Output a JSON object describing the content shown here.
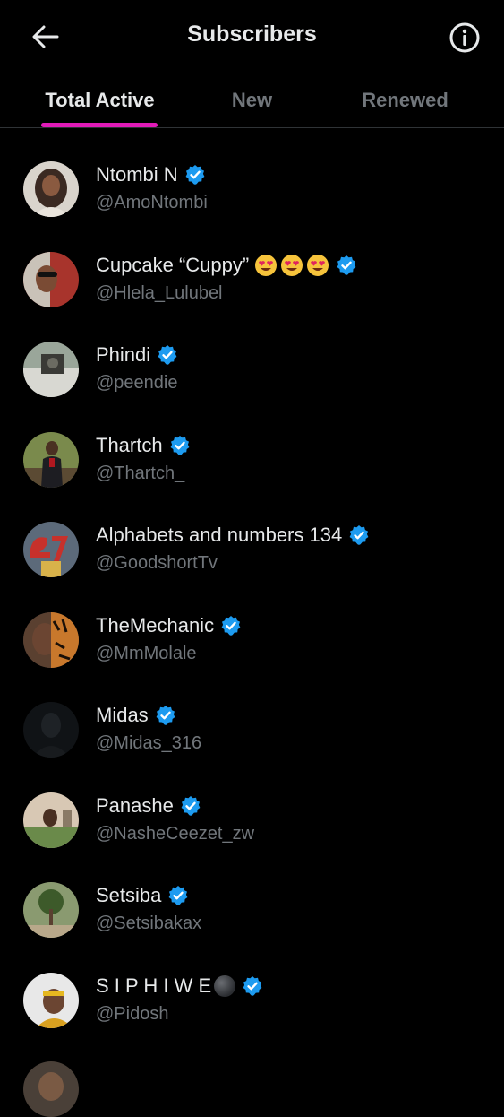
{
  "header": {
    "title": "Subscribers",
    "back_icon": "arrow-left-icon",
    "info_icon": "info-circle-icon"
  },
  "tabs": [
    {
      "label": "Total Active",
      "active": true
    },
    {
      "label": "New",
      "active": false
    },
    {
      "label": "Renewed",
      "active": false
    }
  ],
  "colors": {
    "background": "#000000",
    "primary_text": "#e7e9ea",
    "secondary_text": "#71767b",
    "tab_indicator": "#e11bb8",
    "verified_badge": "#1d9bf0"
  },
  "subscribers": [
    {
      "name": "Ntombi N",
      "handle": "@AmoNtombi",
      "verified": true
    },
    {
      "name": "Cupcake “Cuppy”",
      "handle": "@Hlela_Lulubel",
      "verified": true,
      "emojis": [
        "heart-eyes",
        "heart-eyes",
        "heart-eyes"
      ]
    },
    {
      "name": "Phindi",
      "handle": "@peendie",
      "verified": true
    },
    {
      "name": "Thartch",
      "handle": "@Thartch_",
      "verified": true
    },
    {
      "name": "Alphabets and numbers 134",
      "handle": "@GoodshortTv",
      "verified": true
    },
    {
      "name": "TheMechanic",
      "handle": "@MmMolale",
      "verified": true
    },
    {
      "name": "Midas",
      "handle": "@Midas_316",
      "verified": true
    },
    {
      "name": "Panashe",
      "handle": "@NasheCeezet_zw",
      "verified": true
    },
    {
      "name": "Setsiba",
      "handle": "@Setsibakax",
      "verified": true
    },
    {
      "name": "S I P H I W E",
      "handle": "@Pidosh",
      "verified": true,
      "emojis": [
        "black-circle"
      ]
    }
  ]
}
